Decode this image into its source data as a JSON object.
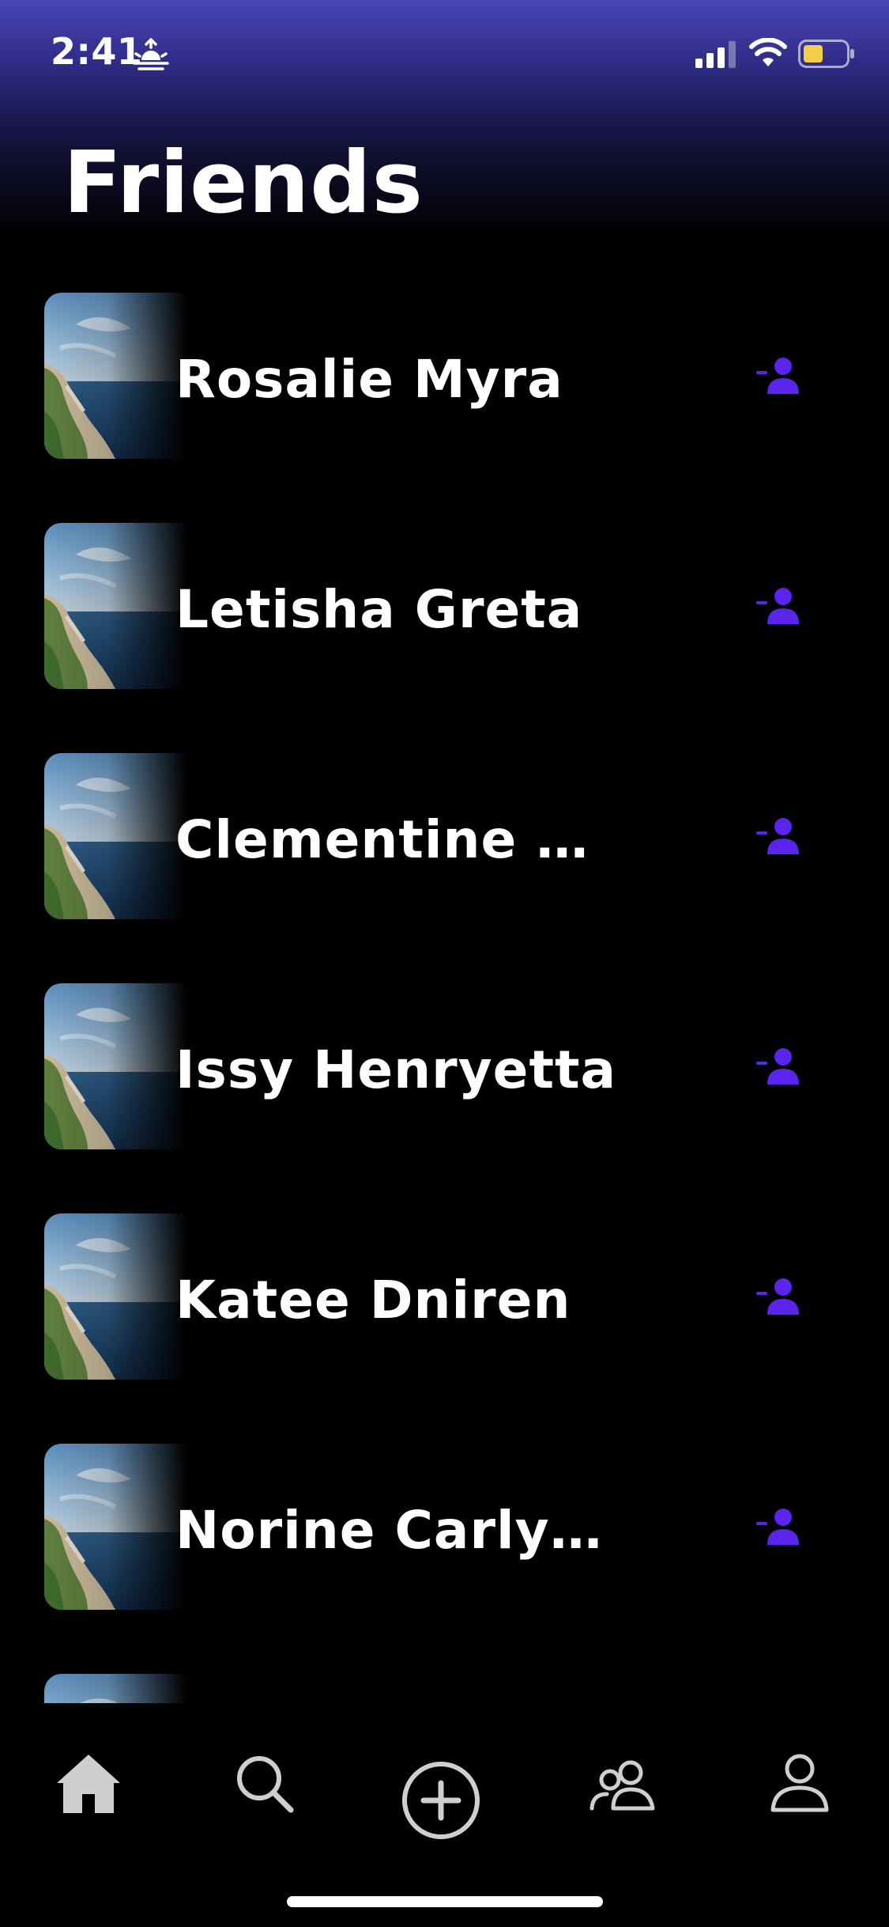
{
  "status_bar": {
    "time": "2:41",
    "icons": [
      "sunrise-icon",
      "cellular-signal-icon",
      "wifi-icon",
      "battery-icon"
    ],
    "battery_color": "#f5cd47"
  },
  "header": {
    "title": "Friends"
  },
  "friends": [
    {
      "name": "Rosalie Myra",
      "action_icon": "remove-friend-icon"
    },
    {
      "name": "Letisha Greta",
      "action_icon": "remove-friend-icon"
    },
    {
      "name": "Clementine M...",
      "action_icon": "remove-friend-icon"
    },
    {
      "name": "Issy Henryetta",
      "action_icon": "remove-friend-icon"
    },
    {
      "name": "Katee Dniren",
      "action_icon": "remove-friend-icon"
    },
    {
      "name": "Norine Carlynne",
      "action_icon": "remove-friend-icon"
    }
  ],
  "tab_bar": {
    "tabs": [
      "home-icon",
      "search-icon",
      "add-icon",
      "friends-icon",
      "profile-icon"
    ],
    "active": "home-icon"
  },
  "colors": {
    "accent": "#5a24ec",
    "background": "#000000",
    "header_gradient_top": "#4a45b8",
    "text": "#ffffff",
    "tab_icon": "#cfcfcf"
  }
}
